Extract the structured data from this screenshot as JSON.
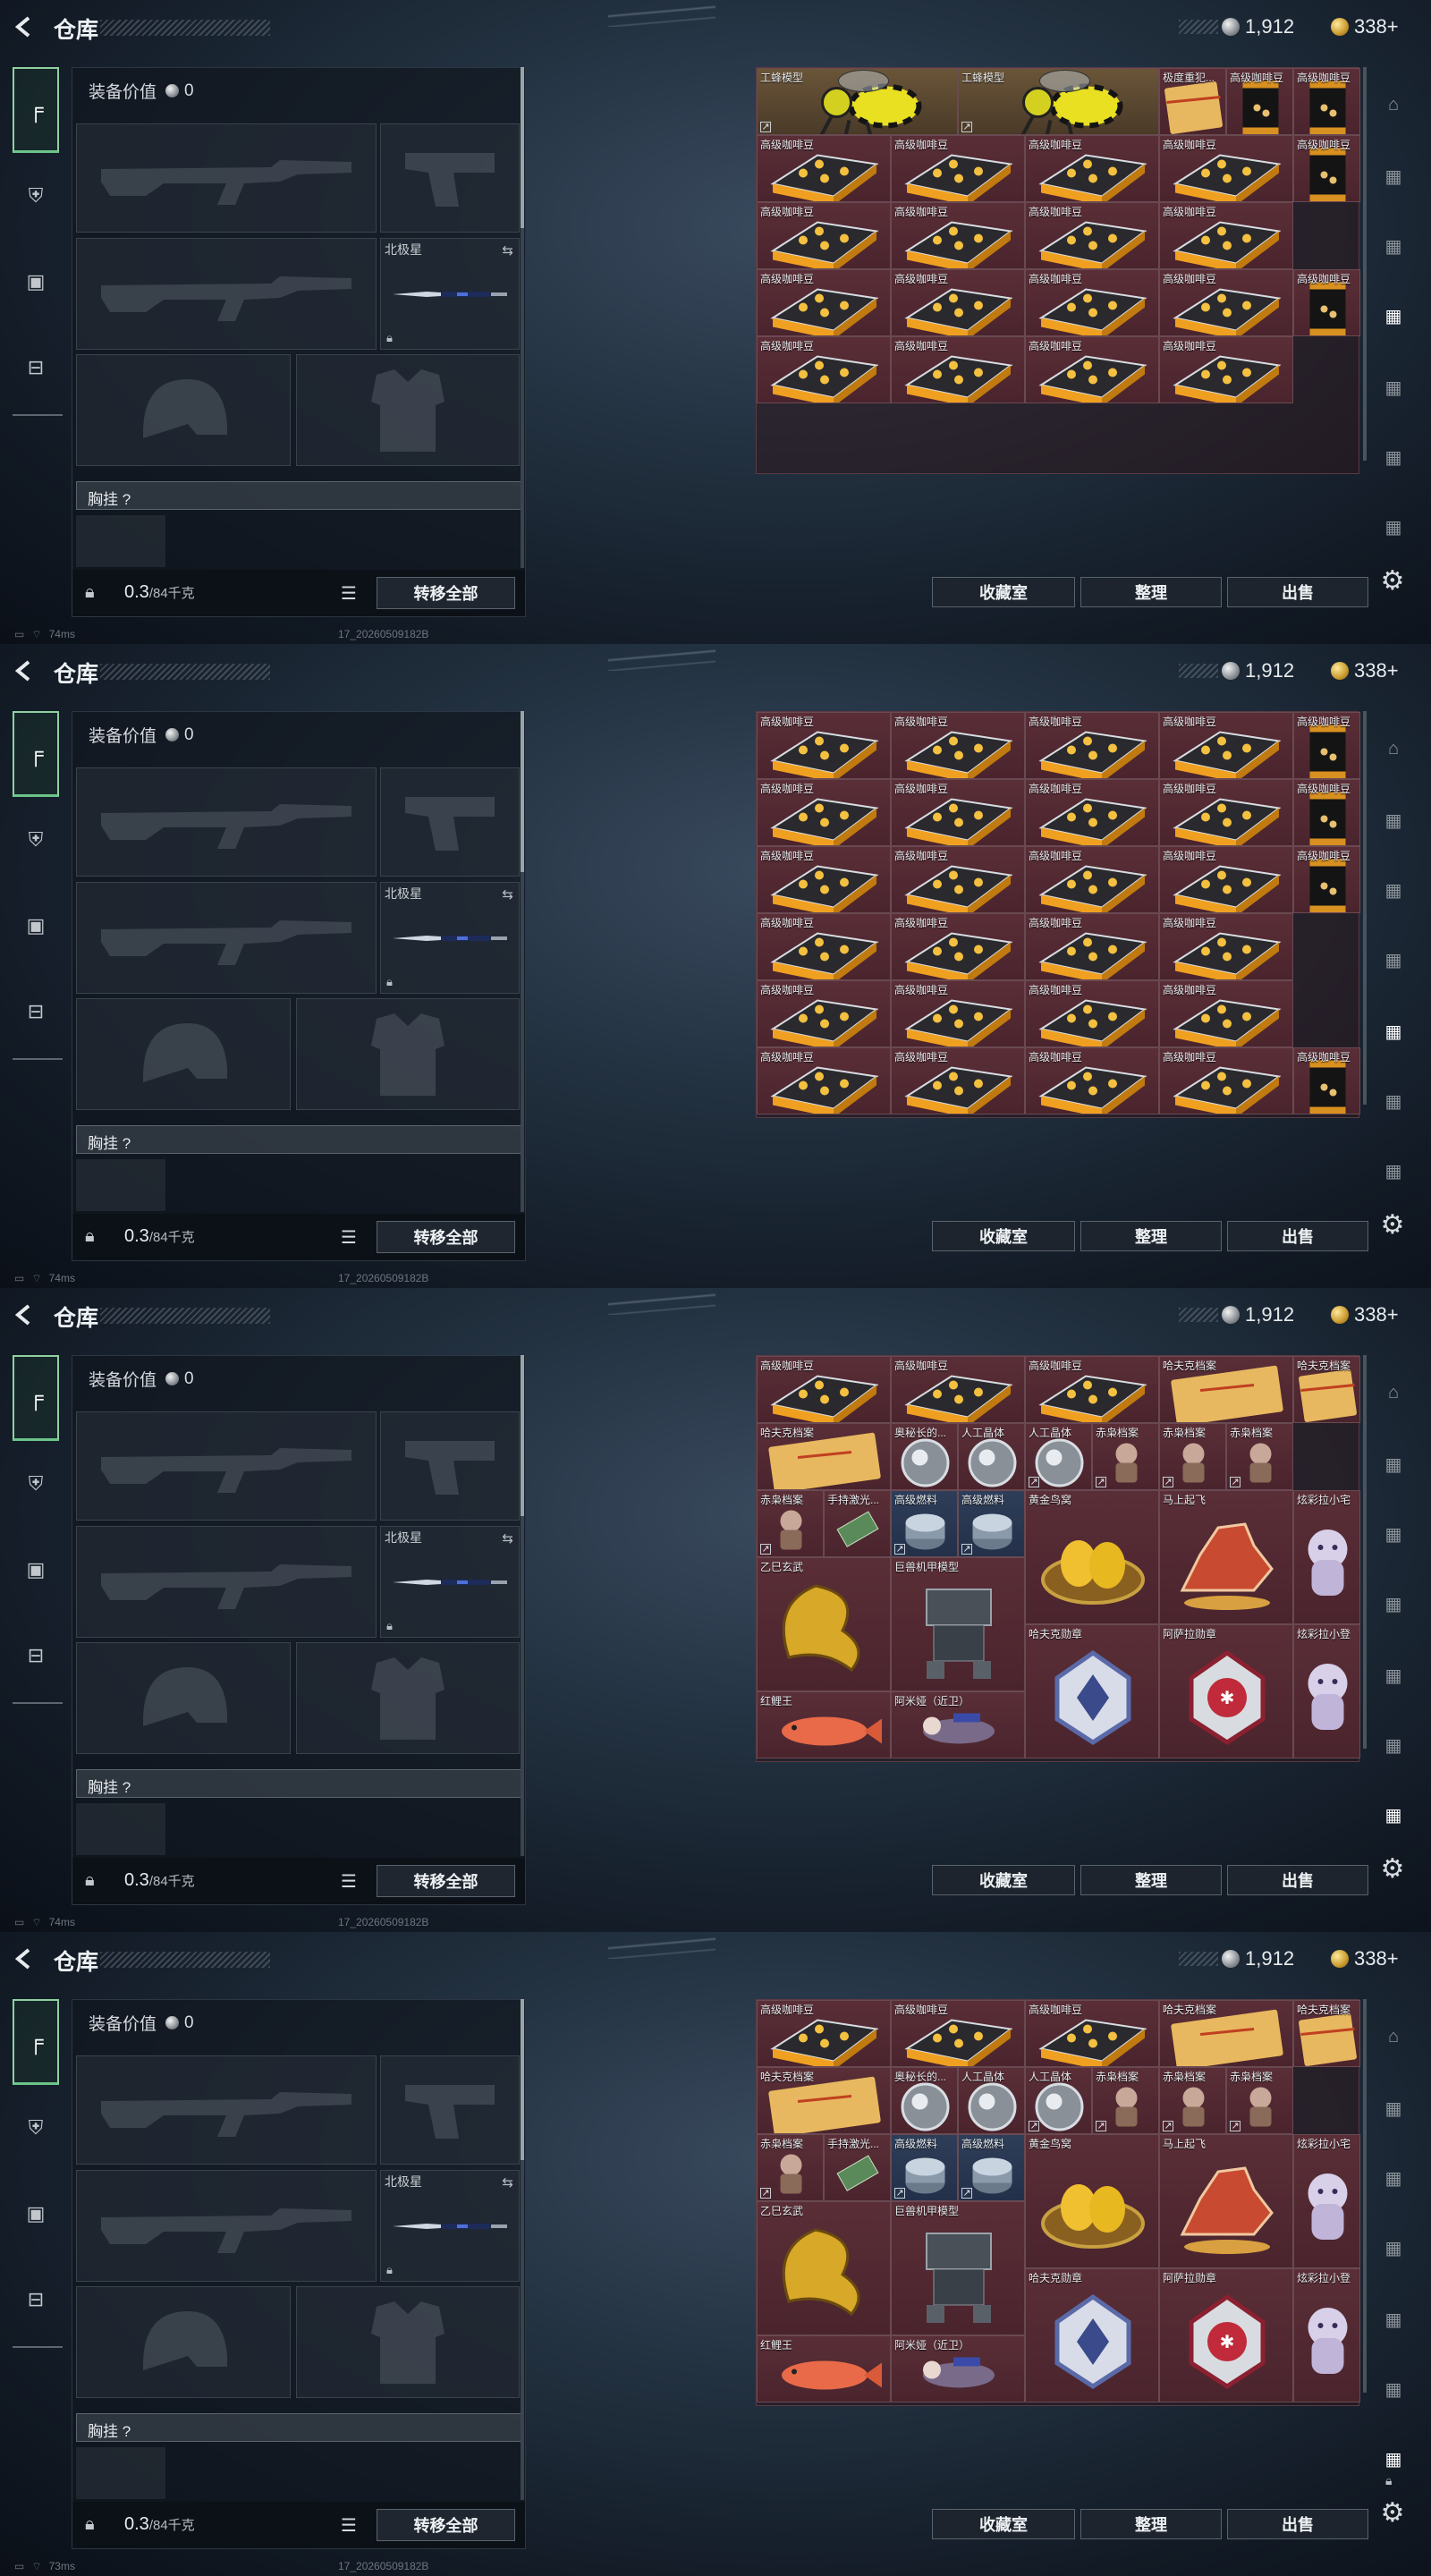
{
  "header": {
    "title": "仓库",
    "silver": "1,912",
    "gold": "338+"
  },
  "equipment_value_label": "装备价值",
  "equipment_value": "0",
  "slots": {
    "knife_label": "北极星"
  },
  "chest_rig_label": "胸挂 ?",
  "weight_value": "0.3",
  "weight_unit": "/84千克",
  "transfer_all": "转移全部",
  "actions": {
    "collection": "收藏室",
    "sort": "整理",
    "sell": "出售"
  },
  "status": {
    "ping": "74ms",
    "ping_last": "73ms",
    "build": "17_20260509182B"
  },
  "screens": [
    {
      "cells": [
        {
          "name": "工蜂模型",
          "type": "wasp",
          "c": 0,
          "r": 0,
          "w": 3,
          "h": 2,
          "color": "gold",
          "tag": true
        },
        {
          "name": "工蜂模型",
          "type": "wasp",
          "c": 3,
          "r": 0,
          "w": 3,
          "h": 2,
          "color": "gold",
          "tag": true
        },
        {
          "name": "极度重犯...",
          "type": "paper",
          "c": 6,
          "r": 0,
          "w": 1,
          "h": 2,
          "color": "red"
        },
        {
          "name": "高级咖啡豆",
          "type": "bag",
          "c": 7,
          "r": 0,
          "w": 1,
          "h": 2,
          "color": "red"
        },
        {
          "name": "高级咖啡豆",
          "type": "bag",
          "c": 8,
          "r": 0,
          "w": 1,
          "h": 2,
          "color": "red"
        },
        {
          "name": "高级咖啡豆",
          "type": "box",
          "c": 0,
          "r": 2,
          "w": 2,
          "h": 2,
          "color": "red"
        },
        {
          "name": "高级咖啡豆",
          "type": "box",
          "c": 2,
          "r": 2,
          "w": 2,
          "h": 2,
          "color": "red"
        },
        {
          "name": "高级咖啡豆",
          "type": "box",
          "c": 4,
          "r": 2,
          "w": 2,
          "h": 2,
          "color": "red"
        },
        {
          "name": "高级咖啡豆",
          "type": "box",
          "c": 6,
          "r": 2,
          "w": 2,
          "h": 2,
          "color": "red"
        },
        {
          "name": "高级咖啡豆",
          "type": "bag",
          "c": 8,
          "r": 2,
          "w": 1,
          "h": 2,
          "color": "red"
        },
        {
          "name": "高级咖啡豆",
          "type": "box",
          "c": 0,
          "r": 4,
          "w": 2,
          "h": 2,
          "color": "red"
        },
        {
          "name": "高级咖啡豆",
          "type": "box",
          "c": 2,
          "r": 4,
          "w": 2,
          "h": 2,
          "color": "red"
        },
        {
          "name": "高级咖啡豆",
          "type": "box",
          "c": 4,
          "r": 4,
          "w": 2,
          "h": 2,
          "color": "red"
        },
        {
          "name": "高级咖啡豆",
          "type": "box",
          "c": 6,
          "r": 4,
          "w": 2,
          "h": 2,
          "color": "red"
        },
        {
          "name": "高级咖啡豆",
          "type": "box",
          "c": 0,
          "r": 6,
          "w": 2,
          "h": 2,
          "color": "red"
        },
        {
          "name": "高级咖啡豆",
          "type": "box",
          "c": 2,
          "r": 6,
          "w": 2,
          "h": 2,
          "color": "red"
        },
        {
          "name": "高级咖啡豆",
          "type": "box",
          "c": 4,
          "r": 6,
          "w": 2,
          "h": 2,
          "color": "red"
        },
        {
          "name": "高级咖啡豆",
          "type": "box",
          "c": 6,
          "r": 6,
          "w": 2,
          "h": 2,
          "color": "red"
        },
        {
          "name": "高级咖啡豆",
          "type": "bag",
          "c": 8,
          "r": 6,
          "w": 1,
          "h": 2,
          "color": "red"
        },
        {
          "name": "高级咖啡豆",
          "type": "box",
          "c": 0,
          "r": 8,
          "w": 2,
          "h": 2,
          "color": "red"
        },
        {
          "name": "高级咖啡豆",
          "type": "box",
          "c": 2,
          "r": 8,
          "w": 2,
          "h": 2,
          "color": "red"
        },
        {
          "name": "高级咖啡豆",
          "type": "box",
          "c": 4,
          "r": 8,
          "w": 2,
          "h": 2,
          "color": "red"
        },
        {
          "name": "高级咖啡豆",
          "type": "box",
          "c": 6,
          "r": 8,
          "w": 2,
          "h": 2,
          "color": "red"
        }
      ]
    },
    {
      "cells": [
        {
          "name": "高级咖啡豆",
          "type": "box",
          "c": 0,
          "r": 0,
          "w": 2,
          "h": 2,
          "color": "red"
        },
        {
          "name": "高级咖啡豆",
          "type": "box",
          "c": 2,
          "r": 0,
          "w": 2,
          "h": 2,
          "color": "red"
        },
        {
          "name": "高级咖啡豆",
          "type": "box",
          "c": 4,
          "r": 0,
          "w": 2,
          "h": 2,
          "color": "red"
        },
        {
          "name": "高级咖啡豆",
          "type": "box",
          "c": 6,
          "r": 0,
          "w": 2,
          "h": 2,
          "color": "red"
        },
        {
          "name": "高级咖啡豆",
          "type": "bag",
          "c": 8,
          "r": 0,
          "w": 1,
          "h": 2,
          "color": "red"
        },
        {
          "name": "高级咖啡豆",
          "type": "box",
          "c": 0,
          "r": 2,
          "w": 2,
          "h": 2,
          "color": "red"
        },
        {
          "name": "高级咖啡豆",
          "type": "box",
          "c": 2,
          "r": 2,
          "w": 2,
          "h": 2,
          "color": "red"
        },
        {
          "name": "高级咖啡豆",
          "type": "box",
          "c": 4,
          "r": 2,
          "w": 2,
          "h": 2,
          "color": "red"
        },
        {
          "name": "高级咖啡豆",
          "type": "box",
          "c": 6,
          "r": 2,
          "w": 2,
          "h": 2,
          "color": "red"
        },
        {
          "name": "高级咖啡豆",
          "type": "box",
          "c": 0,
          "r": 4,
          "w": 2,
          "h": 2,
          "color": "red"
        },
        {
          "name": "高级咖啡豆",
          "type": "box",
          "c": 2,
          "r": 4,
          "w": 2,
          "h": 2,
          "color": "red"
        },
        {
          "name": "高级咖啡豆",
          "type": "box",
          "c": 4,
          "r": 4,
          "w": 2,
          "h": 2,
          "color": "red"
        },
        {
          "name": "高级咖啡豆",
          "type": "box",
          "c": 6,
          "r": 4,
          "w": 2,
          "h": 2,
          "color": "red"
        },
        {
          "name": "高级咖啡豆",
          "type": "bag",
          "c": 8,
          "r": 2,
          "w": 1,
          "h": 2,
          "color": "red"
        },
        {
          "name": "高级咖啡豆",
          "type": "box",
          "c": 0,
          "r": 6,
          "w": 2,
          "h": 2,
          "color": "red"
        },
        {
          "name": "高级咖啡豆",
          "type": "box",
          "c": 2,
          "r": 6,
          "w": 2,
          "h": 2,
          "color": "red"
        },
        {
          "name": "高级咖啡豆",
          "type": "box",
          "c": 4,
          "r": 6,
          "w": 2,
          "h": 2,
          "color": "red"
        },
        {
          "name": "高级咖啡豆",
          "type": "box",
          "c": 6,
          "r": 6,
          "w": 2,
          "h": 2,
          "color": "red"
        },
        {
          "name": "高级咖啡豆",
          "type": "box",
          "c": 0,
          "r": 8,
          "w": 2,
          "h": 2,
          "color": "red"
        },
        {
          "name": "高级咖啡豆",
          "type": "box",
          "c": 2,
          "r": 8,
          "w": 2,
          "h": 2,
          "color": "red"
        },
        {
          "name": "高级咖啡豆",
          "type": "box",
          "c": 4,
          "r": 8,
          "w": 2,
          "h": 2,
          "color": "red"
        },
        {
          "name": "高级咖啡豆",
          "type": "box",
          "c": 6,
          "r": 8,
          "w": 2,
          "h": 2,
          "color": "red"
        },
        {
          "name": "高级咖啡豆",
          "type": "bag",
          "c": 8,
          "r": 4,
          "w": 1,
          "h": 2,
          "color": "red"
        },
        {
          "name": "高级咖啡豆",
          "type": "box",
          "c": 0,
          "r": 10,
          "w": 2,
          "h": 2,
          "color": "red"
        },
        {
          "name": "高级咖啡豆",
          "type": "box",
          "c": 2,
          "r": 10,
          "w": 2,
          "h": 2,
          "color": "red"
        },
        {
          "name": "高级咖啡豆",
          "type": "box",
          "c": 4,
          "r": 10,
          "w": 2,
          "h": 2,
          "color": "red"
        },
        {
          "name": "高级咖啡豆",
          "type": "box",
          "c": 6,
          "r": 10,
          "w": 2,
          "h": 2,
          "color": "red"
        },
        {
          "name": "高级咖啡豆",
          "type": "bag",
          "c": 8,
          "r": 10,
          "w": 1,
          "h": 2,
          "color": "red"
        }
      ]
    },
    {
      "cells": [
        {
          "name": "高级咖啡豆",
          "type": "box",
          "c": 0,
          "r": 0,
          "w": 2,
          "h": 2,
          "color": "red"
        },
        {
          "name": "高级咖啡豆",
          "type": "box",
          "c": 2,
          "r": 0,
          "w": 2,
          "h": 2,
          "color": "red"
        },
        {
          "name": "高级咖啡豆",
          "type": "box",
          "c": 4,
          "r": 0,
          "w": 2,
          "h": 2,
          "color": "red"
        },
        {
          "name": "哈夫克档案",
          "type": "paper",
          "c": 6,
          "r": 0,
          "w": 2,
          "h": 2,
          "color": "red"
        },
        {
          "name": "哈夫克档案",
          "type": "paper",
          "c": 8,
          "r": 0,
          "w": 1,
          "h": 2,
          "color": "red"
        },
        {
          "name": "哈夫克档案",
          "type": "paper",
          "c": 0,
          "r": 2,
          "w": 2,
          "h": 2,
          "color": "red"
        },
        {
          "name": "奥秘长的...",
          "type": "orb",
          "c": 2,
          "r": 2,
          "w": 1,
          "h": 2,
          "color": "red"
        },
        {
          "name": "人工晶体",
          "type": "orb",
          "c": 3,
          "r": 2,
          "w": 1,
          "h": 2,
          "color": "red"
        },
        {
          "name": "人工晶体",
          "type": "orb",
          "c": 4,
          "r": 2,
          "w": 1,
          "h": 2,
          "color": "red",
          "tag": true
        },
        {
          "name": "赤枭档案",
          "type": "doll",
          "c": 5,
          "r": 2,
          "w": 1,
          "h": 2,
          "color": "red",
          "tag": true
        },
        {
          "name": "赤枭档案",
          "type": "doll",
          "c": 6,
          "r": 2,
          "w": 1,
          "h": 2,
          "color": "red",
          "tag": true
        },
        {
          "name": "赤枭档案",
          "type": "doll",
          "c": 7,
          "r": 2,
          "w": 1,
          "h": 2,
          "color": "red",
          "tag": true
        },
        {
          "name": "赤枭档案",
          "type": "doll",
          "c": 0,
          "r": 4,
          "w": 1,
          "h": 2,
          "color": "red",
          "tag": true
        },
        {
          "name": "手持激光...",
          "type": "cash",
          "c": 1,
          "r": 4,
          "w": 1,
          "h": 2,
          "color": "red"
        },
        {
          "name": "高级燃料",
          "type": "can",
          "c": 2,
          "r": 4,
          "w": 1,
          "h": 2,
          "color": "blue",
          "tag": true
        },
        {
          "name": "高级燃料",
          "type": "can",
          "c": 3,
          "r": 4,
          "w": 1,
          "h": 2,
          "color": "blue",
          "tag": true
        },
        {
          "name": "黄金鸟窝",
          "type": "nest",
          "c": 4,
          "r": 4,
          "w": 2,
          "h": 4,
          "color": "red"
        },
        {
          "name": "马上起飞",
          "type": "horse",
          "c": 6,
          "r": 4,
          "w": 2,
          "h": 4,
          "color": "red"
        },
        {
          "name": "炫彩拉小宅",
          "type": "ghost",
          "c": 8,
          "r": 4,
          "w": 1,
          "h": 4,
          "color": "red"
        },
        {
          "name": "乙巳玄武",
          "type": "dragon",
          "c": 0,
          "r": 6,
          "w": 2,
          "h": 4,
          "color": "red"
        },
        {
          "name": "巨兽机甲模型",
          "type": "mech",
          "c": 2,
          "r": 6,
          "w": 2,
          "h": 4,
          "color": "red"
        },
        {
          "name": "哈夫克勋章",
          "type": "medal",
          "c": 4,
          "r": 8,
          "w": 2,
          "h": 4,
          "color": "red"
        },
        {
          "name": "阿萨拉勋章",
          "type": "medal2",
          "c": 6,
          "r": 8,
          "w": 2,
          "h": 4,
          "color": "red"
        },
        {
          "name": "炫彩拉小登",
          "type": "ghost2",
          "c": 8,
          "r": 8,
          "w": 1,
          "h": 4,
          "color": "red"
        },
        {
          "name": "红鲤王",
          "type": "fish",
          "c": 0,
          "r": 10,
          "w": 2,
          "h": 2,
          "color": "red"
        },
        {
          "name": "阿米娅（近卫）",
          "type": "figure",
          "c": 2,
          "r": 10,
          "w": 2,
          "h": 2,
          "color": "red"
        }
      ]
    },
    {
      "cells": [
        {
          "name": "高级咖啡豆",
          "type": "box",
          "c": 0,
          "r": 0,
          "w": 2,
          "h": 2,
          "color": "red"
        },
        {
          "name": "高级咖啡豆",
          "type": "box",
          "c": 2,
          "r": 0,
          "w": 2,
          "h": 2,
          "color": "red"
        },
        {
          "name": "高级咖啡豆",
          "type": "box",
          "c": 4,
          "r": 0,
          "w": 2,
          "h": 2,
          "color": "red"
        },
        {
          "name": "哈夫克档案",
          "type": "paper",
          "c": 6,
          "r": 0,
          "w": 2,
          "h": 2,
          "color": "red"
        },
        {
          "name": "哈夫克档案",
          "type": "paper",
          "c": 8,
          "r": 0,
          "w": 1,
          "h": 2,
          "color": "red"
        },
        {
          "name": "哈夫克档案",
          "type": "paper",
          "c": 0,
          "r": 2,
          "w": 2,
          "h": 2,
          "color": "red"
        },
        {
          "name": "奥秘长的...",
          "type": "orb",
          "c": 2,
          "r": 2,
          "w": 1,
          "h": 2,
          "color": "red"
        },
        {
          "name": "人工晶体",
          "type": "orb",
          "c": 3,
          "r": 2,
          "w": 1,
          "h": 2,
          "color": "red"
        },
        {
          "name": "人工晶体",
          "type": "orb",
          "c": 4,
          "r": 2,
          "w": 1,
          "h": 2,
          "color": "red",
          "tag": true
        },
        {
          "name": "赤枭档案",
          "type": "doll",
          "c": 5,
          "r": 2,
          "w": 1,
          "h": 2,
          "color": "red",
          "tag": true
        },
        {
          "name": "赤枭档案",
          "type": "doll",
          "c": 6,
          "r": 2,
          "w": 1,
          "h": 2,
          "color": "red",
          "tag": true
        },
        {
          "name": "赤枭档案",
          "type": "doll",
          "c": 7,
          "r": 2,
          "w": 1,
          "h": 2,
          "color": "red",
          "tag": true
        },
        {
          "name": "赤枭档案",
          "type": "doll",
          "c": 0,
          "r": 4,
          "w": 1,
          "h": 2,
          "color": "red",
          "tag": true
        },
        {
          "name": "手持激光...",
          "type": "cash",
          "c": 1,
          "r": 4,
          "w": 1,
          "h": 2,
          "color": "red"
        },
        {
          "name": "高级燃料",
          "type": "can",
          "c": 2,
          "r": 4,
          "w": 1,
          "h": 2,
          "color": "blue",
          "tag": true
        },
        {
          "name": "高级燃料",
          "type": "can",
          "c": 3,
          "r": 4,
          "w": 1,
          "h": 2,
          "color": "blue",
          "tag": true
        },
        {
          "name": "黄金鸟窝",
          "type": "nest",
          "c": 4,
          "r": 4,
          "w": 2,
          "h": 4,
          "color": "red"
        },
        {
          "name": "马上起飞",
          "type": "horse",
          "c": 6,
          "r": 4,
          "w": 2,
          "h": 4,
          "color": "red"
        },
        {
          "name": "炫彩拉小宅",
          "type": "ghost",
          "c": 8,
          "r": 4,
          "w": 1,
          "h": 4,
          "color": "red"
        },
        {
          "name": "乙巳玄武",
          "type": "dragon",
          "c": 0,
          "r": 6,
          "w": 2,
          "h": 4,
          "color": "red"
        },
        {
          "name": "巨兽机甲模型",
          "type": "mech",
          "c": 2,
          "r": 6,
          "w": 2,
          "h": 4,
          "color": "red"
        },
        {
          "name": "哈夫克勋章",
          "type": "medal",
          "c": 4,
          "r": 8,
          "w": 2,
          "h": 4,
          "color": "red"
        },
        {
          "name": "阿萨拉勋章",
          "type": "medal2",
          "c": 6,
          "r": 8,
          "w": 2,
          "h": 4,
          "color": "red"
        },
        {
          "name": "炫彩拉小登",
          "type": "ghost2",
          "c": 8,
          "r": 8,
          "w": 1,
          "h": 4,
          "color": "red"
        },
        {
          "name": "红鲤王",
          "type": "fish",
          "c": 0,
          "r": 10,
          "w": 2,
          "h": 2,
          "color": "red"
        },
        {
          "name": "阿米娅（近卫）",
          "type": "figure",
          "c": 2,
          "r": 10,
          "w": 2,
          "h": 2,
          "color": "red"
        }
      ]
    }
  ]
}
